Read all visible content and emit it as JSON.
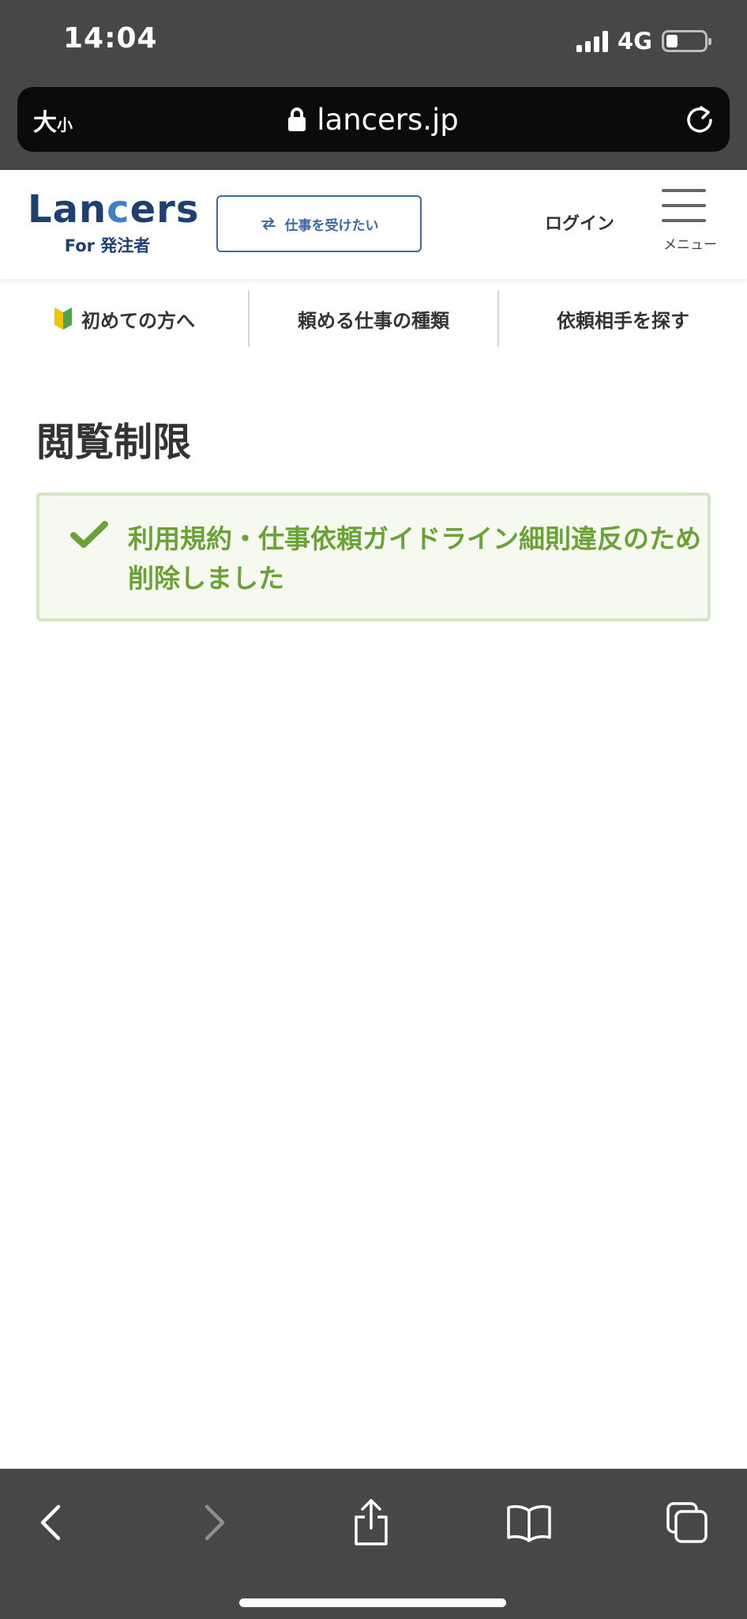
{
  "status_bar": {
    "time": "14:04",
    "network": "4G"
  },
  "address_bar": {
    "text_size_large": "大",
    "text_size_small": "小",
    "url": "lancers.jp"
  },
  "header": {
    "logo_word_prefix": "Lan",
    "logo_word_accent": "c",
    "logo_word_suffix": "ers",
    "logo_sub": "For 発注者",
    "switch_button_label": "仕事を受けたい",
    "login_label": "ログイン",
    "menu_label": "メニュー"
  },
  "sub_nav": {
    "items": [
      {
        "label": "初めての方へ"
      },
      {
        "label": "頼める仕事の種類"
      },
      {
        "label": "依頼相手を探す"
      }
    ]
  },
  "main": {
    "title": "閲覧制限",
    "notice_text": "利用規約・仕事依頼ガイドライン細則違反のため削除しました"
  },
  "colors": {
    "brand_dark": "#1f3f73",
    "brand_accent": "#3f7fc4",
    "success_text": "#6aa236",
    "success_bg": "#f5f9ef",
    "success_border": "#d4e5c3",
    "chrome_bg": "#474747"
  },
  "icons": {
    "lock": "lock-icon",
    "reload": "reload-icon",
    "swap": "swap-arrows-icon",
    "hamburger": "hamburger-icon",
    "beginner": "beginner-mark-icon",
    "check": "check-icon",
    "back": "chevron-left-icon",
    "forward": "chevron-right-icon",
    "share": "share-icon",
    "bookmarks": "book-icon",
    "tabs": "tabs-icon"
  }
}
